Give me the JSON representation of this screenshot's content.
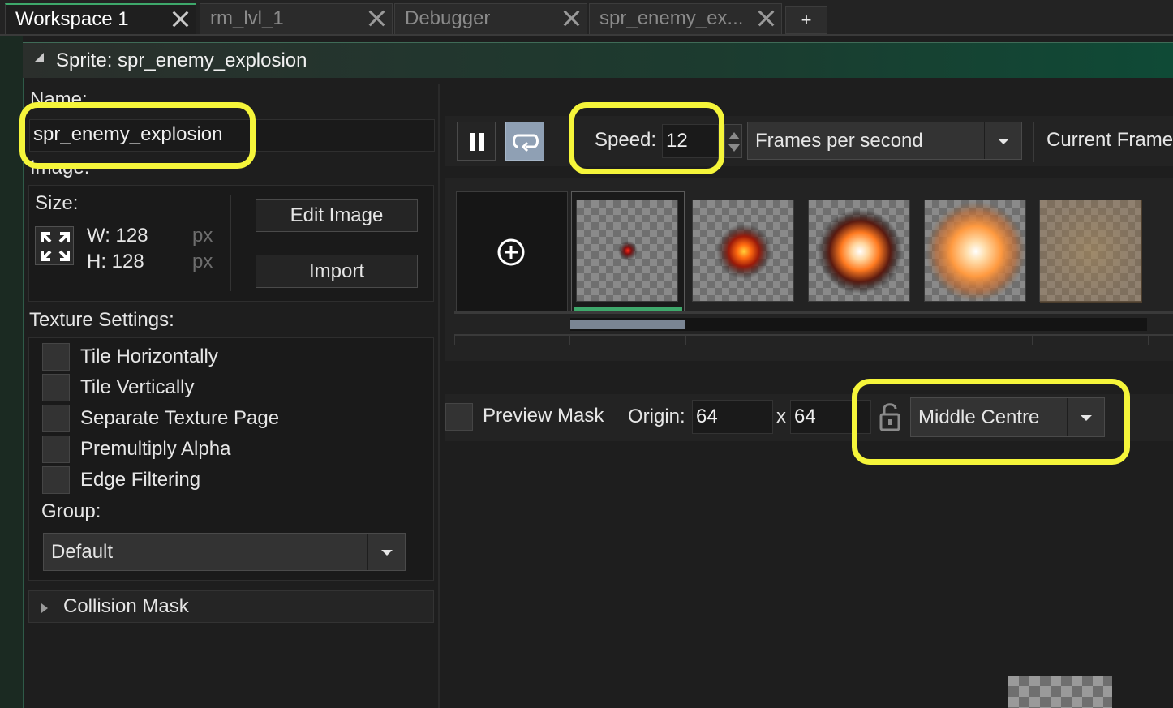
{
  "tabs": [
    {
      "label": "Workspace 1",
      "active": true
    },
    {
      "label": "rm_lvl_1",
      "active": false
    },
    {
      "label": "Debugger",
      "active": false
    },
    {
      "label": "spr_enemy_ex...",
      "active": false
    }
  ],
  "tab_add_label": "+",
  "sprite_header": {
    "title": "Sprite: spr_enemy_explosion"
  },
  "left": {
    "name_label": "Name:",
    "name_value": "spr_enemy_explosion",
    "image_label": "Image:",
    "size_label": "Size:",
    "width": "W: 128",
    "height": "H: 128",
    "px_unit": "px",
    "edit_image": "Edit Image",
    "import": "Import",
    "texture_label": "Texture Settings:",
    "checkboxes": [
      {
        "label": "Tile Horizontally",
        "checked": false
      },
      {
        "label": "Tile Vertically",
        "checked": false
      },
      {
        "label": "Separate Texture Page",
        "checked": false
      },
      {
        "label": "Premultiply Alpha",
        "checked": false
      },
      {
        "label": "Edge Filtering",
        "checked": false
      }
    ],
    "group_label": "Group:",
    "group_value": "Default",
    "collision_label": "Collision Mask"
  },
  "toolbar": {
    "speed_label": "Speed:",
    "speed_value": "12",
    "speed_unit": "Frames per second",
    "current_frame_label": "Current Frame"
  },
  "frames": {
    "count": 5,
    "selected_index": 0
  },
  "origin": {
    "preview_mask_label": "Preview Mask",
    "origin_label": "Origin:",
    "x": "64",
    "separator": "x",
    "y": "64",
    "preset": "Middle Centre"
  },
  "colors": {
    "highlight": "#f5f53a",
    "accent_green": "#3ea86b",
    "panel_bg": "#1e1e1e"
  }
}
